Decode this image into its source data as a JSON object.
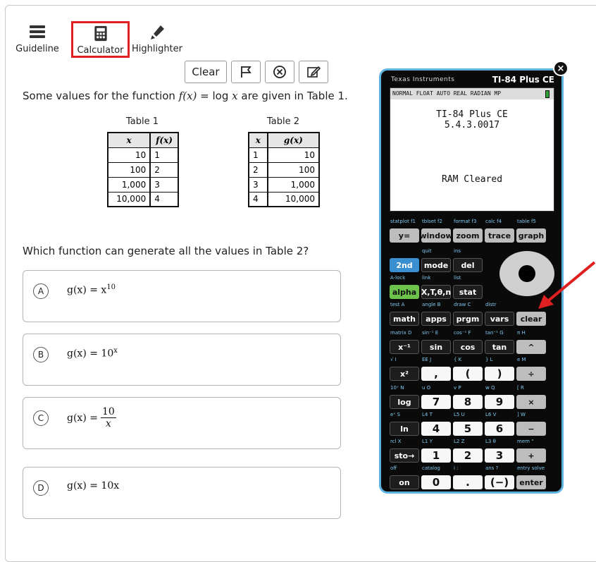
{
  "toolbar": {
    "guideline": "Guideline",
    "calculator": "Calculator",
    "highlighter": "Highlighter"
  },
  "question_tools": {
    "clear": "Clear"
  },
  "stem": {
    "before": "Some values for the function ",
    "fx": "f(x)",
    "mid": " = log ",
    "x": "x",
    "after": " are given in Table 1."
  },
  "table1": {
    "caption": "Table 1",
    "headers": [
      "x",
      "f(x)"
    ],
    "rows": [
      [
        "10",
        "1"
      ],
      [
        "100",
        "2"
      ],
      [
        "1,000",
        "3"
      ],
      [
        "10,000",
        "4"
      ]
    ]
  },
  "table2": {
    "caption": "Table 2",
    "headers": [
      "x",
      "g(x)"
    ],
    "rows": [
      [
        "1",
        "10"
      ],
      [
        "2",
        "100"
      ],
      [
        "3",
        "1,000"
      ],
      [
        "4",
        "10,000"
      ]
    ]
  },
  "question": "Which function can generate all the values in Table 2?",
  "choices": [
    {
      "letter": "A",
      "text": "g(x) = x",
      "sup": "10"
    },
    {
      "letter": "B",
      "text": "g(x) = 10",
      "sup": "x"
    },
    {
      "letter": "C",
      "text": "g(x) = ",
      "num": "10",
      "den": "x"
    },
    {
      "letter": "D",
      "text": "g(x) = 10x"
    }
  ],
  "calculator": {
    "brand": "Texas Instruments",
    "model": "TI-84 Plus CE",
    "status": "NORMAL FLOAT AUTO REAL RADIAN MP",
    "screen_line1": "TI-84 Plus CE",
    "screen_line2": "5.4.3.0017",
    "screen_msg": "RAM Cleared",
    "close": "×"
  },
  "keys": {
    "row1": [
      {
        "sec": "statplot f1",
        "face": "y="
      },
      {
        "sec": "tblset f2",
        "face": "window"
      },
      {
        "sec": "format f3",
        "face": "zoom"
      },
      {
        "sec": "calc f4",
        "face": "trace"
      },
      {
        "sec": "table f5",
        "face": "graph"
      }
    ],
    "row2": [
      {
        "sec": "",
        "face": "2nd"
      },
      {
        "sec": "quit",
        "face": "mode"
      },
      {
        "sec": "ins",
        "face": "del"
      }
    ],
    "row3": [
      {
        "sec": "A-lock",
        "face": "alpha"
      },
      {
        "sec": "link",
        "face": "X,T,θ,n"
      },
      {
        "sec": "list",
        "face": "stat"
      }
    ],
    "row4": [
      {
        "sec": "test A",
        "face": "math"
      },
      {
        "sec": "angle B",
        "face": "apps"
      },
      {
        "sec": "draw C",
        "face": "prgm"
      },
      {
        "sec": "distr",
        "face": "vars"
      },
      {
        "sec": "",
        "face": "clear"
      }
    ],
    "row5": [
      {
        "sec": "matrix D",
        "face": "x⁻¹"
      },
      {
        "sec": "sin⁻¹ E",
        "face": "sin"
      },
      {
        "sec": "cos⁻¹ F",
        "face": "cos"
      },
      {
        "sec": "tan⁻¹ G",
        "face": "tan"
      },
      {
        "sec": "π H",
        "face": "^"
      }
    ],
    "row6": [
      {
        "sec": "√ I",
        "face": "x²"
      },
      {
        "sec": "EE J",
        "face": ","
      },
      {
        "sec": "{ K",
        "face": "("
      },
      {
        "sec": "} L",
        "face": ")"
      },
      {
        "sec": "e M",
        "face": "÷"
      }
    ],
    "row7": [
      {
        "sec": "10ˣ N",
        "face": "log"
      },
      {
        "sec": "u O",
        "face": "7"
      },
      {
        "sec": "v P",
        "face": "8"
      },
      {
        "sec": "w Q",
        "face": "9"
      },
      {
        "sec": "[ R",
        "face": "×"
      }
    ],
    "row8": [
      {
        "sec": "eˣ S",
        "face": "ln"
      },
      {
        "sec": "L4 T",
        "face": "4"
      },
      {
        "sec": "L5 U",
        "face": "5"
      },
      {
        "sec": "L6 V",
        "face": "6"
      },
      {
        "sec": "] W",
        "face": "−"
      }
    ],
    "row9": [
      {
        "sec": "rcl X",
        "face": "sto→"
      },
      {
        "sec": "L1 Y",
        "face": "1"
      },
      {
        "sec": "L2 Z",
        "face": "2"
      },
      {
        "sec": "L3 θ",
        "face": "3"
      },
      {
        "sec": "mem “",
        "face": "+"
      }
    ],
    "row10": [
      {
        "sec": "off",
        "face": "on"
      },
      {
        "sec": "catalog",
        "face": "0"
      },
      {
        "sec": "i :",
        "face": "."
      },
      {
        "sec": "ans ?",
        "face": "(−)"
      },
      {
        "sec": "entry solve",
        "face": "enter"
      }
    ]
  }
}
